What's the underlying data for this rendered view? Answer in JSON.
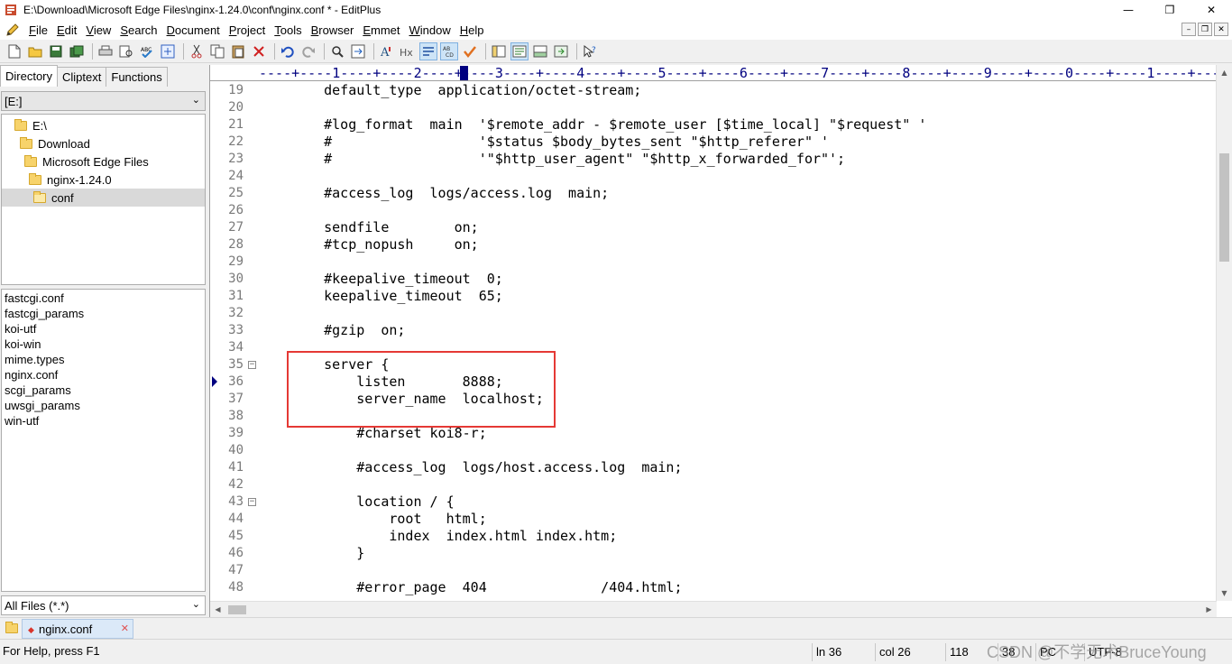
{
  "window": {
    "title": "E:\\Download\\Microsoft Edge Files\\nginx-1.24.0\\conf\\nginx.conf * - EditPlus",
    "minimize": "—",
    "maximize": "❐",
    "close": "✕"
  },
  "menu": [
    "File",
    "Edit",
    "View",
    "Search",
    "Document",
    "Project",
    "Tools",
    "Browser",
    "Emmet",
    "Window",
    "Help"
  ],
  "mdi": {
    "minimize": "–",
    "restore": "❐",
    "close": "✕"
  },
  "toolbar_icons": [
    "new-file-icon",
    "open-folder-icon",
    "save-icon",
    "save-all-icon",
    "print-icon",
    "print-preview-icon",
    "spell-check-icon",
    "browser-icon",
    "cut-icon",
    "copy-icon",
    "paste-icon",
    "delete-icon",
    "undo-icon",
    "redo-icon",
    "find-icon",
    "replace-icon",
    "font-icon",
    "heading-icon",
    "word-wrap-icon",
    "ruler-icon",
    "spell-mark-icon",
    "directory-window-icon",
    "cliptext-window-icon",
    "output-window-icon",
    "user-tool-icon",
    "help-icon"
  ],
  "left_panel": {
    "tabs": [
      "Directory",
      "Cliptext",
      "Functions"
    ],
    "drive": "[E:]",
    "tree": [
      {
        "label": "E:\\",
        "indent": 0
      },
      {
        "label": "Download",
        "indent": 1
      },
      {
        "label": "Microsoft Edge Files",
        "indent": 2
      },
      {
        "label": "nginx-1.24.0",
        "indent": 3
      },
      {
        "label": "conf",
        "indent": 4,
        "selected": true
      }
    ],
    "files": [
      "fastcgi.conf",
      "fastcgi_params",
      "koi-utf",
      "koi-win",
      "mime.types",
      "nginx.conf",
      "scgi_params",
      "uwsgi_params",
      "win-utf"
    ],
    "filter": "All Files (*.*)"
  },
  "editor": {
    "ruler": "----+----1----+----2----+----3----+----4----+----5----+----6----+----7----+----8----+----9----+----0----+----1----+----",
    "lines": [
      {
        "n": "19",
        "text": "    default_type  application/octet-stream;"
      },
      {
        "n": "20",
        "text": ""
      },
      {
        "n": "21",
        "text": "    #log_format  main  '$remote_addr - $remote_user [$time_local] \"$request\" '"
      },
      {
        "n": "22",
        "text": "    #                  '$status $body_bytes_sent \"$http_referer\" '"
      },
      {
        "n": "23",
        "text": "    #                  '\"$http_user_agent\" \"$http_x_forwarded_for\"';"
      },
      {
        "n": "24",
        "text": ""
      },
      {
        "n": "25",
        "text": "    #access_log  logs/access.log  main;"
      },
      {
        "n": "26",
        "text": ""
      },
      {
        "n": "27",
        "text": "    sendfile        on;"
      },
      {
        "n": "28",
        "text": "    #tcp_nopush     on;"
      },
      {
        "n": "29",
        "text": ""
      },
      {
        "n": "30",
        "text": "    #keepalive_timeout  0;"
      },
      {
        "n": "31",
        "text": "    keepalive_timeout  65;"
      },
      {
        "n": "32",
        "text": ""
      },
      {
        "n": "33",
        "text": "    #gzip  on;"
      },
      {
        "n": "34",
        "text": ""
      },
      {
        "n": "35",
        "text": "    server {",
        "fold": "⊟"
      },
      {
        "n": "36",
        "text": "        listen       8888;"
      },
      {
        "n": "37",
        "text": "        server_name  localhost;"
      },
      {
        "n": "38",
        "text": ""
      },
      {
        "n": "39",
        "text": "        #charset koi8-r;"
      },
      {
        "n": "40",
        "text": ""
      },
      {
        "n": "41",
        "text": "        #access_log  logs/host.access.log  main;"
      },
      {
        "n": "42",
        "text": ""
      },
      {
        "n": "43",
        "text": "        location / {",
        "fold": "⊟"
      },
      {
        "n": "44",
        "text": "            root   html;"
      },
      {
        "n": "45",
        "text": "            index  index.html index.htm;"
      },
      {
        "n": "46",
        "text": "        }"
      },
      {
        "n": "47",
        "text": ""
      },
      {
        "n": "48",
        "text": "        #error_page  404              /404.html;"
      }
    ]
  },
  "doc_tab": {
    "label": "nginx.conf",
    "modified_mark": "◆",
    "close": "✕"
  },
  "status": {
    "help": "For Help, press F1",
    "ln": "ln 36",
    "col": "col 26",
    "chars": "118",
    "extra": "38",
    "mode": "PC",
    "encoding": "UTF-8"
  },
  "watermark": "CSDN @不学无术BruceYoung"
}
